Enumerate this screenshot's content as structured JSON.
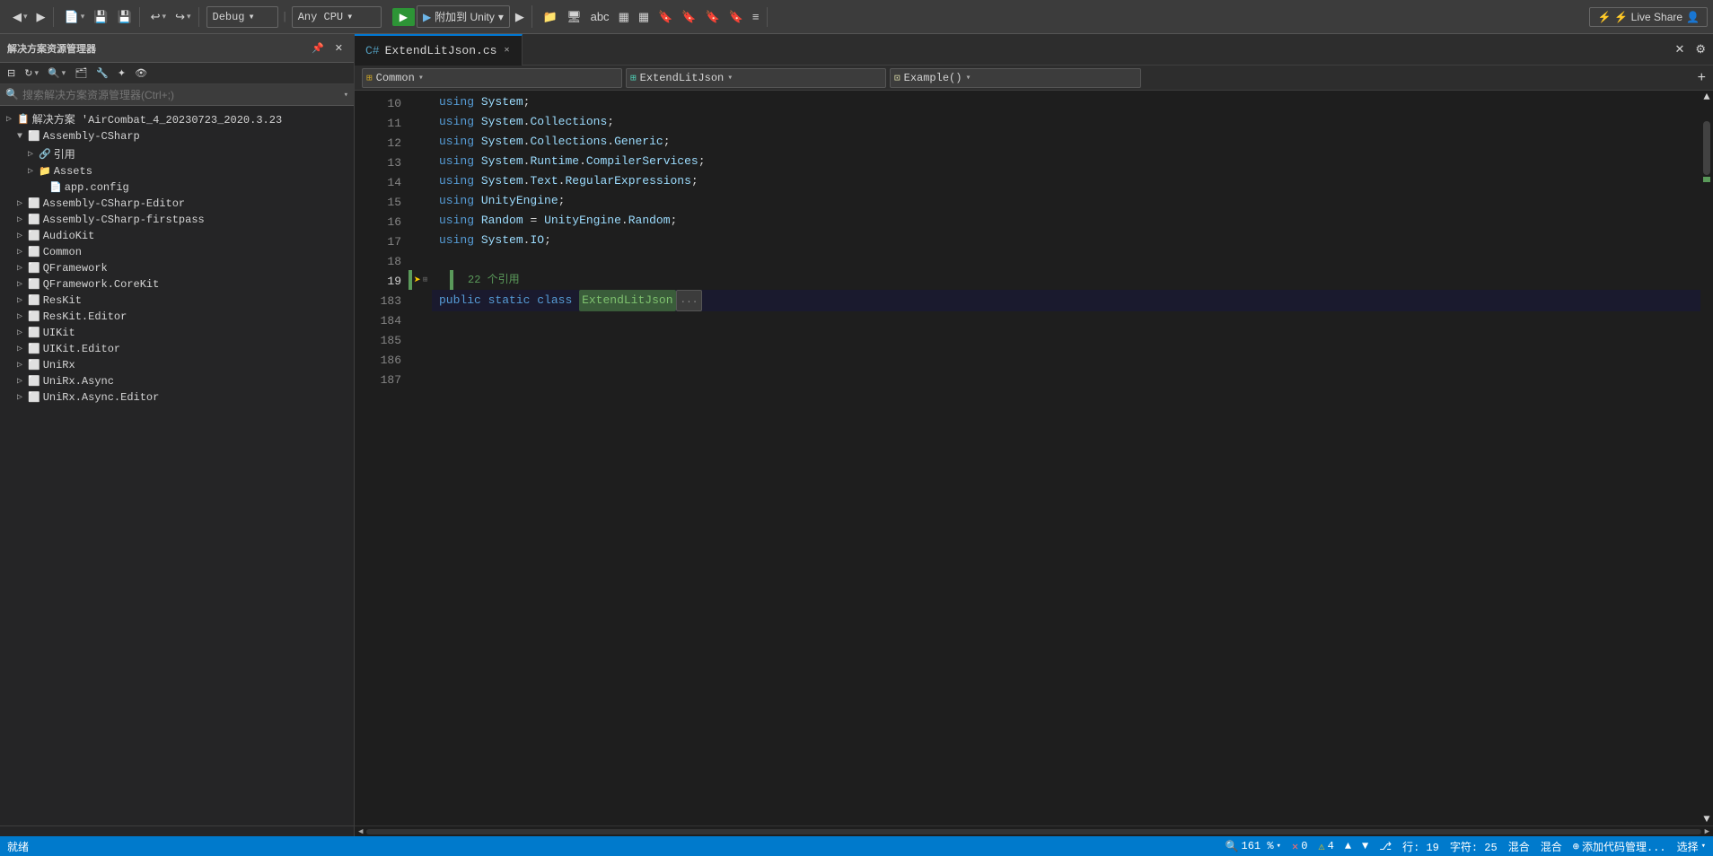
{
  "toolbar": {
    "back_btn": "◀",
    "forward_btn": "▶",
    "undo_label": "↩",
    "redo_label": "↪",
    "debug_label": "Debug",
    "cpu_label": "Any CPU",
    "run_label": "▶",
    "attach_label": "附加到 Unity",
    "run2_label": "▶",
    "live_share_label": "⚡ Live Share"
  },
  "sidebar": {
    "title": "解决方案资源管理器",
    "search_placeholder": "搜索解决方案资源管理器(Ctrl+;)",
    "solution_name": "解决方案 'AirCombat_4_20230723_2020.3.23",
    "items": [
      {
        "id": "assembly-csharp",
        "label": "Assembly-CSharp",
        "level": 1,
        "expanded": true,
        "icon": "ns"
      },
      {
        "id": "references",
        "label": "引用",
        "level": 2,
        "expanded": false,
        "icon": "ref"
      },
      {
        "id": "assets",
        "label": "Assets",
        "level": 2,
        "expanded": false,
        "icon": "folder"
      },
      {
        "id": "app-config",
        "label": "app.config",
        "level": 3,
        "expanded": false,
        "icon": "config"
      },
      {
        "id": "assembly-csharp-editor",
        "label": "Assembly-CSharp-Editor",
        "level": 1,
        "expanded": false,
        "icon": "ns"
      },
      {
        "id": "assembly-csharp-firstpass",
        "label": "Assembly-CSharp-firstpass",
        "level": 1,
        "expanded": false,
        "icon": "ns"
      },
      {
        "id": "audiokit",
        "label": "AudioKit",
        "level": 1,
        "expanded": false,
        "icon": "ns"
      },
      {
        "id": "common",
        "label": "Common",
        "level": 1,
        "expanded": false,
        "icon": "ns"
      },
      {
        "id": "qframework",
        "label": "QFramework",
        "level": 1,
        "expanded": false,
        "icon": "ns"
      },
      {
        "id": "qframework-corekit",
        "label": "QFramework.CoreKit",
        "level": 1,
        "expanded": false,
        "icon": "ns"
      },
      {
        "id": "reskit",
        "label": "ResKit",
        "level": 1,
        "expanded": false,
        "icon": "ns"
      },
      {
        "id": "reskit-editor",
        "label": "ResKit.Editor",
        "level": 1,
        "expanded": false,
        "icon": "ns"
      },
      {
        "id": "uikit",
        "label": "UIKit",
        "level": 1,
        "expanded": false,
        "icon": "ns"
      },
      {
        "id": "uikit-editor",
        "label": "UIKit.Editor",
        "level": 1,
        "expanded": false,
        "icon": "ns"
      },
      {
        "id": "unirx",
        "label": "UniRx",
        "level": 1,
        "expanded": false,
        "icon": "ns"
      },
      {
        "id": "unirx-async",
        "label": "UniRx.Async",
        "level": 1,
        "expanded": false,
        "icon": "ns"
      },
      {
        "id": "unirx-async-editor",
        "label": "UniRx.Async.Editor",
        "level": 1,
        "expanded": false,
        "icon": "ns"
      }
    ]
  },
  "editor": {
    "tab_label": "ExtendLitJson.cs",
    "namespace_label": "Common",
    "class_label": "ExtendLitJson",
    "method_label": "Example()",
    "lines": [
      {
        "num": 10,
        "content_type": "using",
        "ns": "System",
        "suffix": ";"
      },
      {
        "num": 11,
        "content_type": "using",
        "ns": "System.Collections",
        "suffix": ";"
      },
      {
        "num": 12,
        "content_type": "using",
        "ns": "System.Collections.Generic",
        "suffix": ";"
      },
      {
        "num": 13,
        "content_type": "using",
        "ns": "System.Runtime.CompilerServices",
        "suffix": ";"
      },
      {
        "num": 14,
        "content_type": "using",
        "ns": "System.Text.RegularExpressions",
        "suffix": ";"
      },
      {
        "num": 15,
        "content_type": "using",
        "ns": "UnityEngine",
        "suffix": ";"
      },
      {
        "num": 16,
        "content_type": "using_alias",
        "alias": "Random",
        "ns": "UnityEngine",
        "type": "Random",
        "suffix": ";"
      },
      {
        "num": 17,
        "content_type": "using",
        "ns": "System.IO",
        "suffix": ";"
      },
      {
        "num": 18,
        "content_type": "empty"
      },
      {
        "num": 19,
        "content_type": "class_decl",
        "hint": "22 个引用",
        "modifier1": "public",
        "modifier2": "static",
        "keyword": "class",
        "class_name": "ExtendLitJson",
        "collapsed": "..."
      },
      {
        "num": 183,
        "content_type": "empty"
      },
      {
        "num": 184,
        "content_type": "empty"
      },
      {
        "num": 185,
        "content_type": "empty"
      },
      {
        "num": 186,
        "content_type": "empty"
      },
      {
        "num": 187,
        "content_type": "empty"
      }
    ]
  },
  "status_bar": {
    "error_count": "0",
    "warn_count": "4",
    "line_info": "行: 19",
    "char_info": "字符: 25",
    "encoding": "混合",
    "line_ending": "混合",
    "add_code_label": "添加代码管理...",
    "status_label": "就绪",
    "select_label": "选择"
  },
  "zoom": {
    "level": "161 %"
  }
}
